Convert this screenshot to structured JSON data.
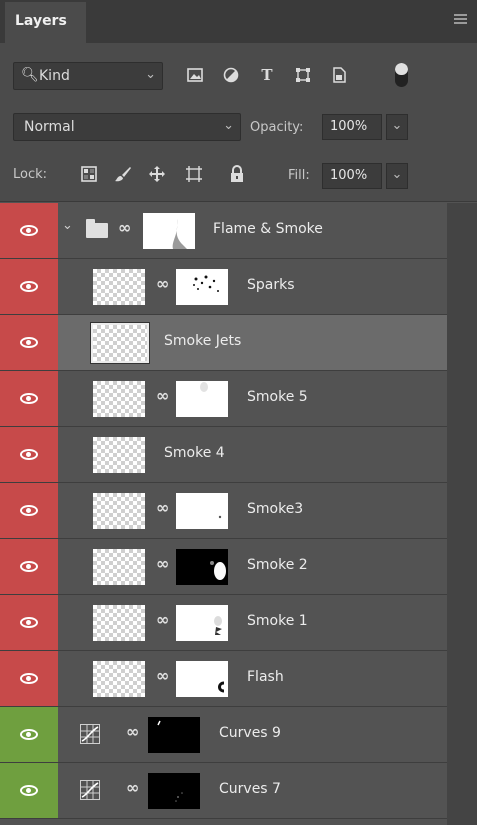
{
  "panel": {
    "tab_label": "Layers"
  },
  "filter": {
    "kind_label": "Kind"
  },
  "blend": {
    "mode": "Normal",
    "opacity_label": "Opacity:",
    "opacity_value": "100%",
    "fill_label": "Fill:",
    "fill_value": "100%"
  },
  "lock": {
    "label": "Lock:"
  },
  "colors": {
    "eye_red": "#c74a4a",
    "eye_green": "#6f9f3f",
    "selected_row": "#6b6b6b"
  },
  "layers": [
    {
      "name": "Flame & Smoke",
      "type": "group",
      "eye_color": "red"
    },
    {
      "name": "Sparks",
      "type": "masked",
      "eye_color": "red"
    },
    {
      "name": "Smoke Jets",
      "type": "plain",
      "eye_color": "red",
      "selected": true
    },
    {
      "name": "Smoke 5",
      "type": "masked",
      "eye_color": "red"
    },
    {
      "name": "Smoke 4",
      "type": "plain",
      "eye_color": "red"
    },
    {
      "name": "Smoke3",
      "type": "masked",
      "eye_color": "red"
    },
    {
      "name": "Smoke 2",
      "type": "masked",
      "eye_color": "red"
    },
    {
      "name": "Smoke 1",
      "type": "masked",
      "eye_color": "red"
    },
    {
      "name": "Flash",
      "type": "masked",
      "eye_color": "red"
    },
    {
      "name": "Curves 9",
      "type": "adjustment",
      "eye_color": "green"
    },
    {
      "name": "Curves 7",
      "type": "adjustment",
      "eye_color": "green"
    }
  ]
}
